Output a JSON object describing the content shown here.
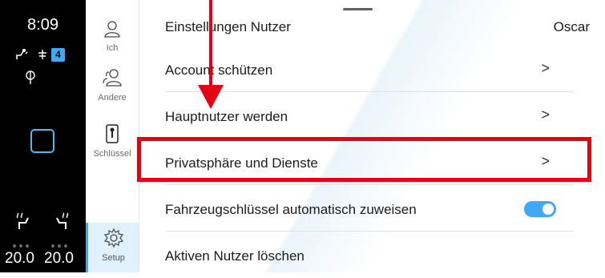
{
  "status": {
    "clock": "8:09",
    "badge_number": "4",
    "temp_left": "20.0",
    "temp_right": "20.0"
  },
  "nav": {
    "items": [
      {
        "label": "Ich",
        "icon": "person-icon"
      },
      {
        "label": "Andere",
        "icon": "people-icon"
      },
      {
        "label": "Schlüssel",
        "icon": "key-fob-icon"
      },
      {
        "label": "Setup",
        "icon": "gear-icon"
      }
    ]
  },
  "settings": {
    "title": "Einstellungen Nutzer",
    "user_name": "Oscar",
    "rows": [
      {
        "label": "Account schützen",
        "chevron": ">"
      },
      {
        "label": "Hauptnutzer werden",
        "chevron": ">"
      },
      {
        "label": "Privatsphäre und Dienste",
        "chevron": ">"
      },
      {
        "label": "Fahrzeugschlüssel automatisch zuweisen",
        "toggle": true
      },
      {
        "label": "Aktiven Nutzer löschen"
      }
    ]
  },
  "colors": {
    "accent": "#3fa9f5",
    "annotation": "#e60012"
  }
}
